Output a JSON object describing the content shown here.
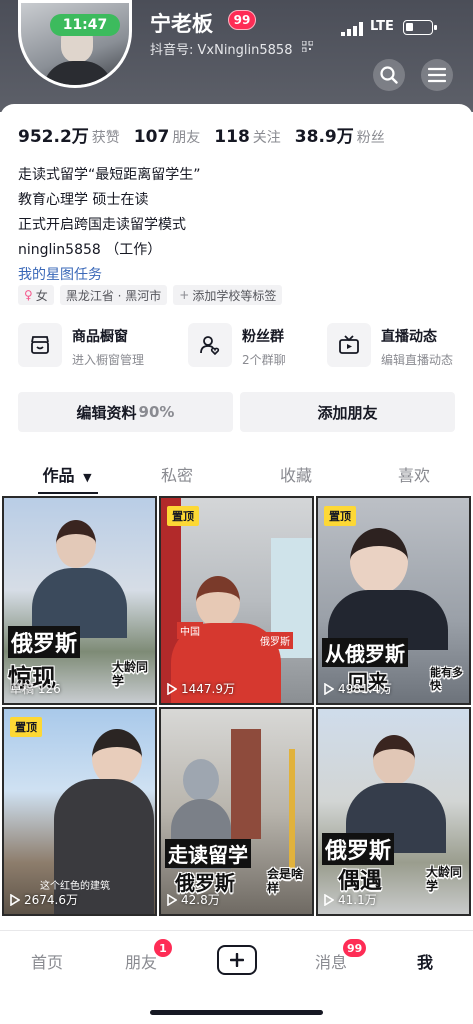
{
  "status_bar": {
    "time": "11:47",
    "network": "LTE"
  },
  "profile": {
    "nickname": "宁老板",
    "nickname_badge": "99",
    "account_id": "抖音号: VxNinglin5858",
    "stats": [
      {
        "value": "952.2万",
        "label": "获赞"
      },
      {
        "value": "107",
        "label": "朋友"
      },
      {
        "value": "118",
        "label": "关注"
      },
      {
        "value": "38.9万",
        "label": "粉丝"
      }
    ],
    "bio_lines": [
      "走读式留学“最短距离留学生”",
      "教育心理学 硕士在读",
      "正式开启跨国走读留学模式",
      "ninglin5858 （工作）"
    ],
    "bio_link": "我的星图任务",
    "tags": {
      "gender": "女",
      "location": "黑龙江省 · 黑河市",
      "add_school": "添加学校等标签"
    }
  },
  "tools": [
    {
      "title": "商品橱窗",
      "subtitle": "进入橱窗管理",
      "icon": "shop-icon"
    },
    {
      "title": "粉丝群",
      "subtitle": "2个群聊",
      "icon": "fans-group-icon"
    },
    {
      "title": "直播动态",
      "subtitle": "编辑直播动态",
      "icon": "live-tv-icon"
    }
  ],
  "actions": {
    "edit_profile": "编辑资料",
    "edit_percent": "90%",
    "add_friend": "添加朋友"
  },
  "tabs": [
    "作品",
    "私密",
    "收藏",
    "喜欢"
  ],
  "videos": [
    {
      "pinned": false,
      "caption_line1": "俄罗斯",
      "caption_line2": "惊现",
      "caption_side": "大龄同学",
      "plays": "草稿 126"
    },
    {
      "pinned": true,
      "pin_label": "置顶",
      "caption_line1": "中国",
      "caption_line2": "俄罗斯",
      "caption_side": "",
      "plays": "1447.9万"
    },
    {
      "pinned": true,
      "pin_label": "置顶",
      "caption_line1": "从俄罗斯",
      "caption_line2": "回来",
      "caption_side": "能有多快",
      "plays": "4981.4万"
    },
    {
      "pinned": true,
      "pin_label": "置顶",
      "caption_line1": "这个红色的建筑",
      "caption_line2": "",
      "caption_side": "",
      "plays": "2674.6万"
    },
    {
      "pinned": false,
      "caption_line1": "走读留学",
      "caption_line2": "俄罗斯",
      "caption_side": "会是啥样",
      "plays": "42.8万"
    },
    {
      "pinned": false,
      "caption_line1": "俄罗斯",
      "caption_line2": "偶遇",
      "caption_side": "大龄同学",
      "plays": "41.1万"
    }
  ],
  "bottom_nav": {
    "home": "首页",
    "friends": "朋友",
    "friends_badge": "1",
    "messages": "消息",
    "messages_badge": "99",
    "me": "我"
  },
  "colors": {
    "accent_red": "#fe2c55",
    "pin_yellow": "#fdd835",
    "link_blue": "#3a68b8",
    "live_green": "#3cbb5d"
  }
}
